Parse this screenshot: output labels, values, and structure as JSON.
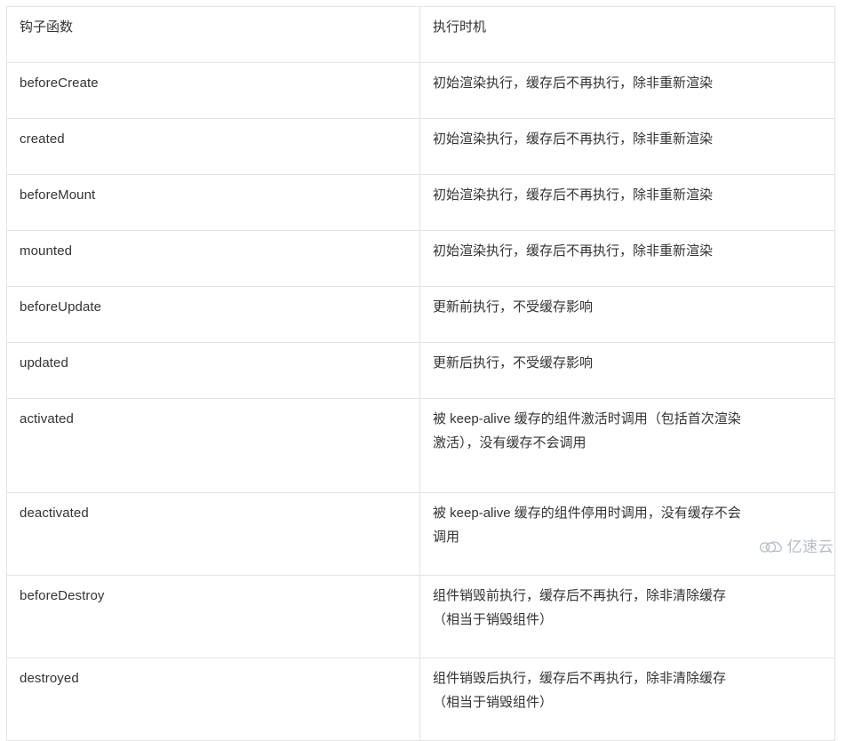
{
  "table": {
    "columns": [
      "钩子函数",
      "执行时机"
    ],
    "rows": [
      {
        "hook": "beforeCreate",
        "timing": "初始渲染执行，缓存后不再执行，除非重新渲染",
        "lines": 1
      },
      {
        "hook": "created",
        "timing": "初始渲染执行，缓存后不再执行，除非重新渲染",
        "lines": 1
      },
      {
        "hook": "beforeMount",
        "timing": "初始渲染执行，缓存后不再执行，除非重新渲染",
        "lines": 1
      },
      {
        "hook": "mounted",
        "timing": "初始渲染执行，缓存后不再执行，除非重新渲染",
        "lines": 1
      },
      {
        "hook": "beforeUpdate",
        "timing": "更新前执行，不受缓存影响",
        "lines": 1
      },
      {
        "hook": "updated",
        "timing": "更新后执行，不受缓存影响",
        "lines": 1
      },
      {
        "hook": "activated",
        "timing": "被 keep-alive 缓存的组件激活时调用（包括首次渲染\n激活），没有缓存不会调用",
        "lines": 2
      },
      {
        "hook": "deactivated",
        "timing": "被 keep-alive 缓存的组件停用时调用，没有缓存不会\n调用",
        "lines": 2
      },
      {
        "hook": "beforeDestroy",
        "timing": "组件销毁前执行，缓存后不再执行，除非清除缓存\n（相当于销毁组件）",
        "lines": 2
      },
      {
        "hook": "destroyed",
        "timing": "组件销毁后执行，缓存后不再执行，除非清除缓存\n（相当于销毁组件）",
        "lines": 2
      }
    ]
  },
  "watermark": {
    "text": "亿速云",
    "icon": "cloud-logo-icon",
    "color": "#8a93a6"
  },
  "theme": {
    "background": "#ffffff",
    "text_color": "#333333",
    "border_color": "#e3e3e3"
  }
}
